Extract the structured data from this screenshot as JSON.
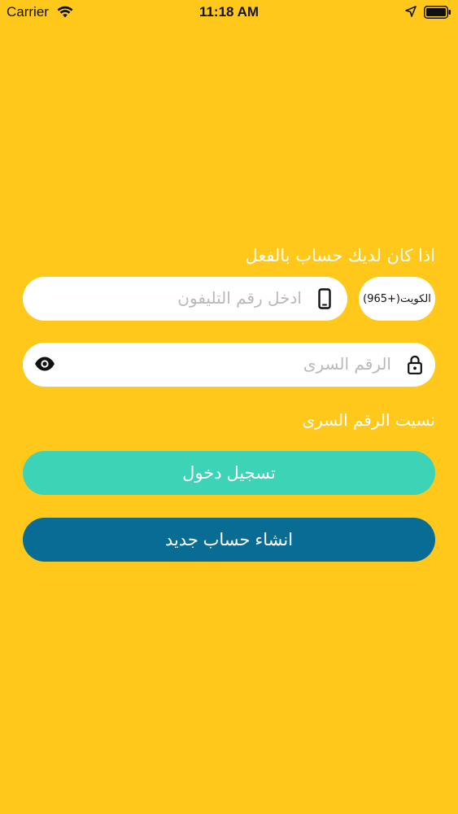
{
  "status_bar": {
    "carrier": "Carrier",
    "time": "11:18 AM"
  },
  "login": {
    "title": "اذا كان لديك حساب بالفعل",
    "country_code": "(965+)الكويت",
    "phone_placeholder": "ادخل رقم التليفون",
    "password_placeholder": "الرقم السرى",
    "forgot_password": "نسيت الرقم السرى",
    "login_button": "تسجيل دخول",
    "register_button": "انشاء حساب جديد"
  },
  "colors": {
    "background": "#FFC81B",
    "login_button": "#3CD3B7",
    "register_button": "#086C95",
    "placeholder": "#B9B9B9"
  },
  "icons": {
    "phone_field": "mobile-phone-icon",
    "password_field": "lock-icon",
    "password_visibility": "eye-icon"
  }
}
